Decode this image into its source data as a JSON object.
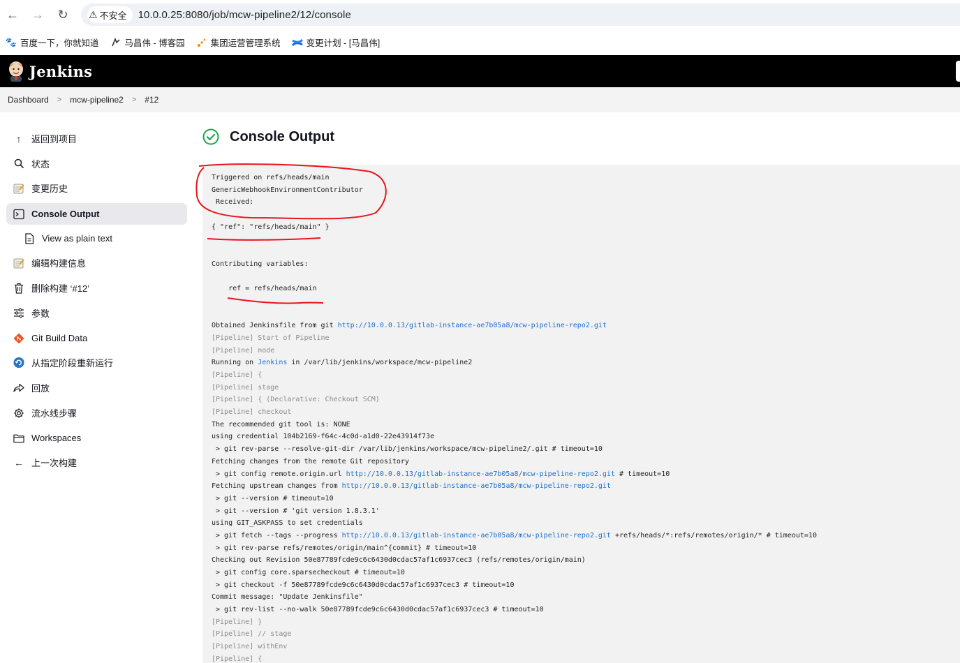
{
  "browser": {
    "back_icon": "←",
    "forward_icon": "→",
    "reload_icon": "↻",
    "security_label": "不安全",
    "url": "10.0.0.25:8080/job/mcw-pipeline2/12/console"
  },
  "bookmarks": [
    {
      "label": "百度一下，你就知道",
      "icon": "baidu-paw-icon"
    },
    {
      "label": "马昌伟 - 博客园",
      "icon": "cnblogs-icon"
    },
    {
      "label": "集团运营管理系统",
      "icon": "ops-system-icon"
    },
    {
      "label": "变更计划 - [马昌伟]",
      "icon": "confluence-icon"
    }
  ],
  "header": {
    "title": "Jenkins"
  },
  "breadcrumbs": [
    "Dashboard",
    "mcw-pipeline2",
    "#12"
  ],
  "sidebar": {
    "items": [
      {
        "label": "返回到项目",
        "icon": "arrow-up-icon"
      },
      {
        "label": "状态",
        "icon": "search-icon"
      },
      {
        "label": "变更历史",
        "icon": "notepad-icon"
      },
      {
        "label": "Console Output",
        "icon": "terminal-icon"
      },
      {
        "label": "View as plain text",
        "icon": "document-icon"
      },
      {
        "label": "编辑构建信息",
        "icon": "notepad-icon"
      },
      {
        "label": "删除构建 ‘#12’",
        "icon": "trash-icon"
      },
      {
        "label": "参数",
        "icon": "sliders-icon"
      },
      {
        "label": "Git Build Data",
        "icon": "git-icon"
      },
      {
        "label": "从指定阶段重新运行",
        "icon": "restart-icon"
      },
      {
        "label": "回放",
        "icon": "replay-icon"
      },
      {
        "label": "流水线步骤",
        "icon": "gear-icon"
      },
      {
        "label": "Workspaces",
        "icon": "folder-icon"
      },
      {
        "label": "上一次构建",
        "icon": "arrow-left-icon"
      }
    ],
    "active_index": 3
  },
  "main": {
    "title": "Console Output",
    "status": "success"
  },
  "console": {
    "lines": [
      [
        {
          "t": "Triggered on refs/heads/main"
        }
      ],
      [
        {
          "t": "GenericWebhookEnvironmentContributor"
        }
      ],
      [
        {
          "t": " Received:"
        }
      ],
      [
        {
          "t": ""
        }
      ],
      [
        {
          "t": "{ \"ref\": \"refs/heads/main\" }"
        }
      ],
      [
        {
          "t": ""
        }
      ],
      [
        {
          "t": ""
        }
      ],
      [
        {
          "t": "Contributing variables:"
        }
      ],
      [
        {
          "t": ""
        }
      ],
      [
        {
          "t": "    ref = refs/heads/main"
        }
      ],
      [
        {
          "t": ""
        }
      ],
      [
        {
          "t": ""
        }
      ],
      [
        {
          "t": "Obtained Jenkinsfile from git "
        },
        {
          "t": "http://10.0.0.13/gitlab-instance-ae7b05a8/mcw-pipeline-repo2.git",
          "k": "link"
        }
      ],
      [
        {
          "t": "[Pipeline] Start of Pipeline",
          "k": "dim"
        }
      ],
      [
        {
          "t": "[Pipeline] node",
          "k": "dim"
        }
      ],
      [
        {
          "t": "Running on "
        },
        {
          "t": "Jenkins",
          "k": "link"
        },
        {
          "t": " in /var/lib/jenkins/workspace/mcw-pipeline2"
        }
      ],
      [
        {
          "t": "[Pipeline] {",
          "k": "dim"
        }
      ],
      [
        {
          "t": "[Pipeline] stage",
          "k": "dim"
        }
      ],
      [
        {
          "t": "[Pipeline] { (Declarative: Checkout SCM)",
          "k": "dim"
        }
      ],
      [
        {
          "t": "[Pipeline] checkout",
          "k": "dim"
        }
      ],
      [
        {
          "t": "The recommended git tool is: NONE"
        }
      ],
      [
        {
          "t": "using credential 104b2169-f64c-4c0d-a1d0-22e43914f73e"
        }
      ],
      [
        {
          "t": " > git rev-parse --resolve-git-dir /var/lib/jenkins/workspace/mcw-pipeline2/.git # timeout=10"
        }
      ],
      [
        {
          "t": "Fetching changes from the remote Git repository"
        }
      ],
      [
        {
          "t": " > git config remote.origin.url "
        },
        {
          "t": "http://10.0.0.13/gitlab-instance-ae7b05a8/mcw-pipeline-repo2.git",
          "k": "link"
        },
        {
          "t": " # timeout=10"
        }
      ],
      [
        {
          "t": "Fetching upstream changes from "
        },
        {
          "t": "http://10.0.0.13/gitlab-instance-ae7b05a8/mcw-pipeline-repo2.git",
          "k": "link"
        }
      ],
      [
        {
          "t": " > git --version # timeout=10"
        }
      ],
      [
        {
          "t": " > git --version # 'git version 1.8.3.1'"
        }
      ],
      [
        {
          "t": "using GIT_ASKPASS to set credentials"
        }
      ],
      [
        {
          "t": " > git fetch --tags --progress "
        },
        {
          "t": "http://10.0.0.13/gitlab-instance-ae7b05a8/mcw-pipeline-repo2.git",
          "k": "link"
        },
        {
          "t": " +refs/heads/*:refs/remotes/origin/* # timeout=10"
        }
      ],
      [
        {
          "t": " > git rev-parse refs/remotes/origin/main^{commit} # timeout=10"
        }
      ],
      [
        {
          "t": "Checking out Revision 50e87789fcde9c6c6430d0cdac57af1c6937cec3 (refs/remotes/origin/main)"
        }
      ],
      [
        {
          "t": " > git config core.sparsecheckout # timeout=10"
        }
      ],
      [
        {
          "t": " > git checkout -f 50e87789fcde9c6c6430d0cdac57af1c6937cec3 # timeout=10"
        }
      ],
      [
        {
          "t": "Commit message: \"Update Jenkinsfile\""
        }
      ],
      [
        {
          "t": " > git rev-list --no-walk 50e87789fcde9c6c6430d0cdac57af1c6937cec3 # timeout=10"
        }
      ],
      [
        {
          "t": "[Pipeline] }",
          "k": "dim"
        }
      ],
      [
        {
          "t": "[Pipeline] // stage",
          "k": "dim"
        }
      ],
      [
        {
          "t": "[Pipeline] withEnv",
          "k": "dim"
        }
      ],
      [
        {
          "t": "[Pipeline] {",
          "k": "dim"
        }
      ]
    ]
  },
  "colors": {
    "header_bg": "#000000",
    "breadcrumb_bg": "#f3f3f4",
    "console_bg": "#f2f2f2",
    "link": "#1a6fd1",
    "success": "#1ea64b",
    "annotation": "#e8141b"
  }
}
